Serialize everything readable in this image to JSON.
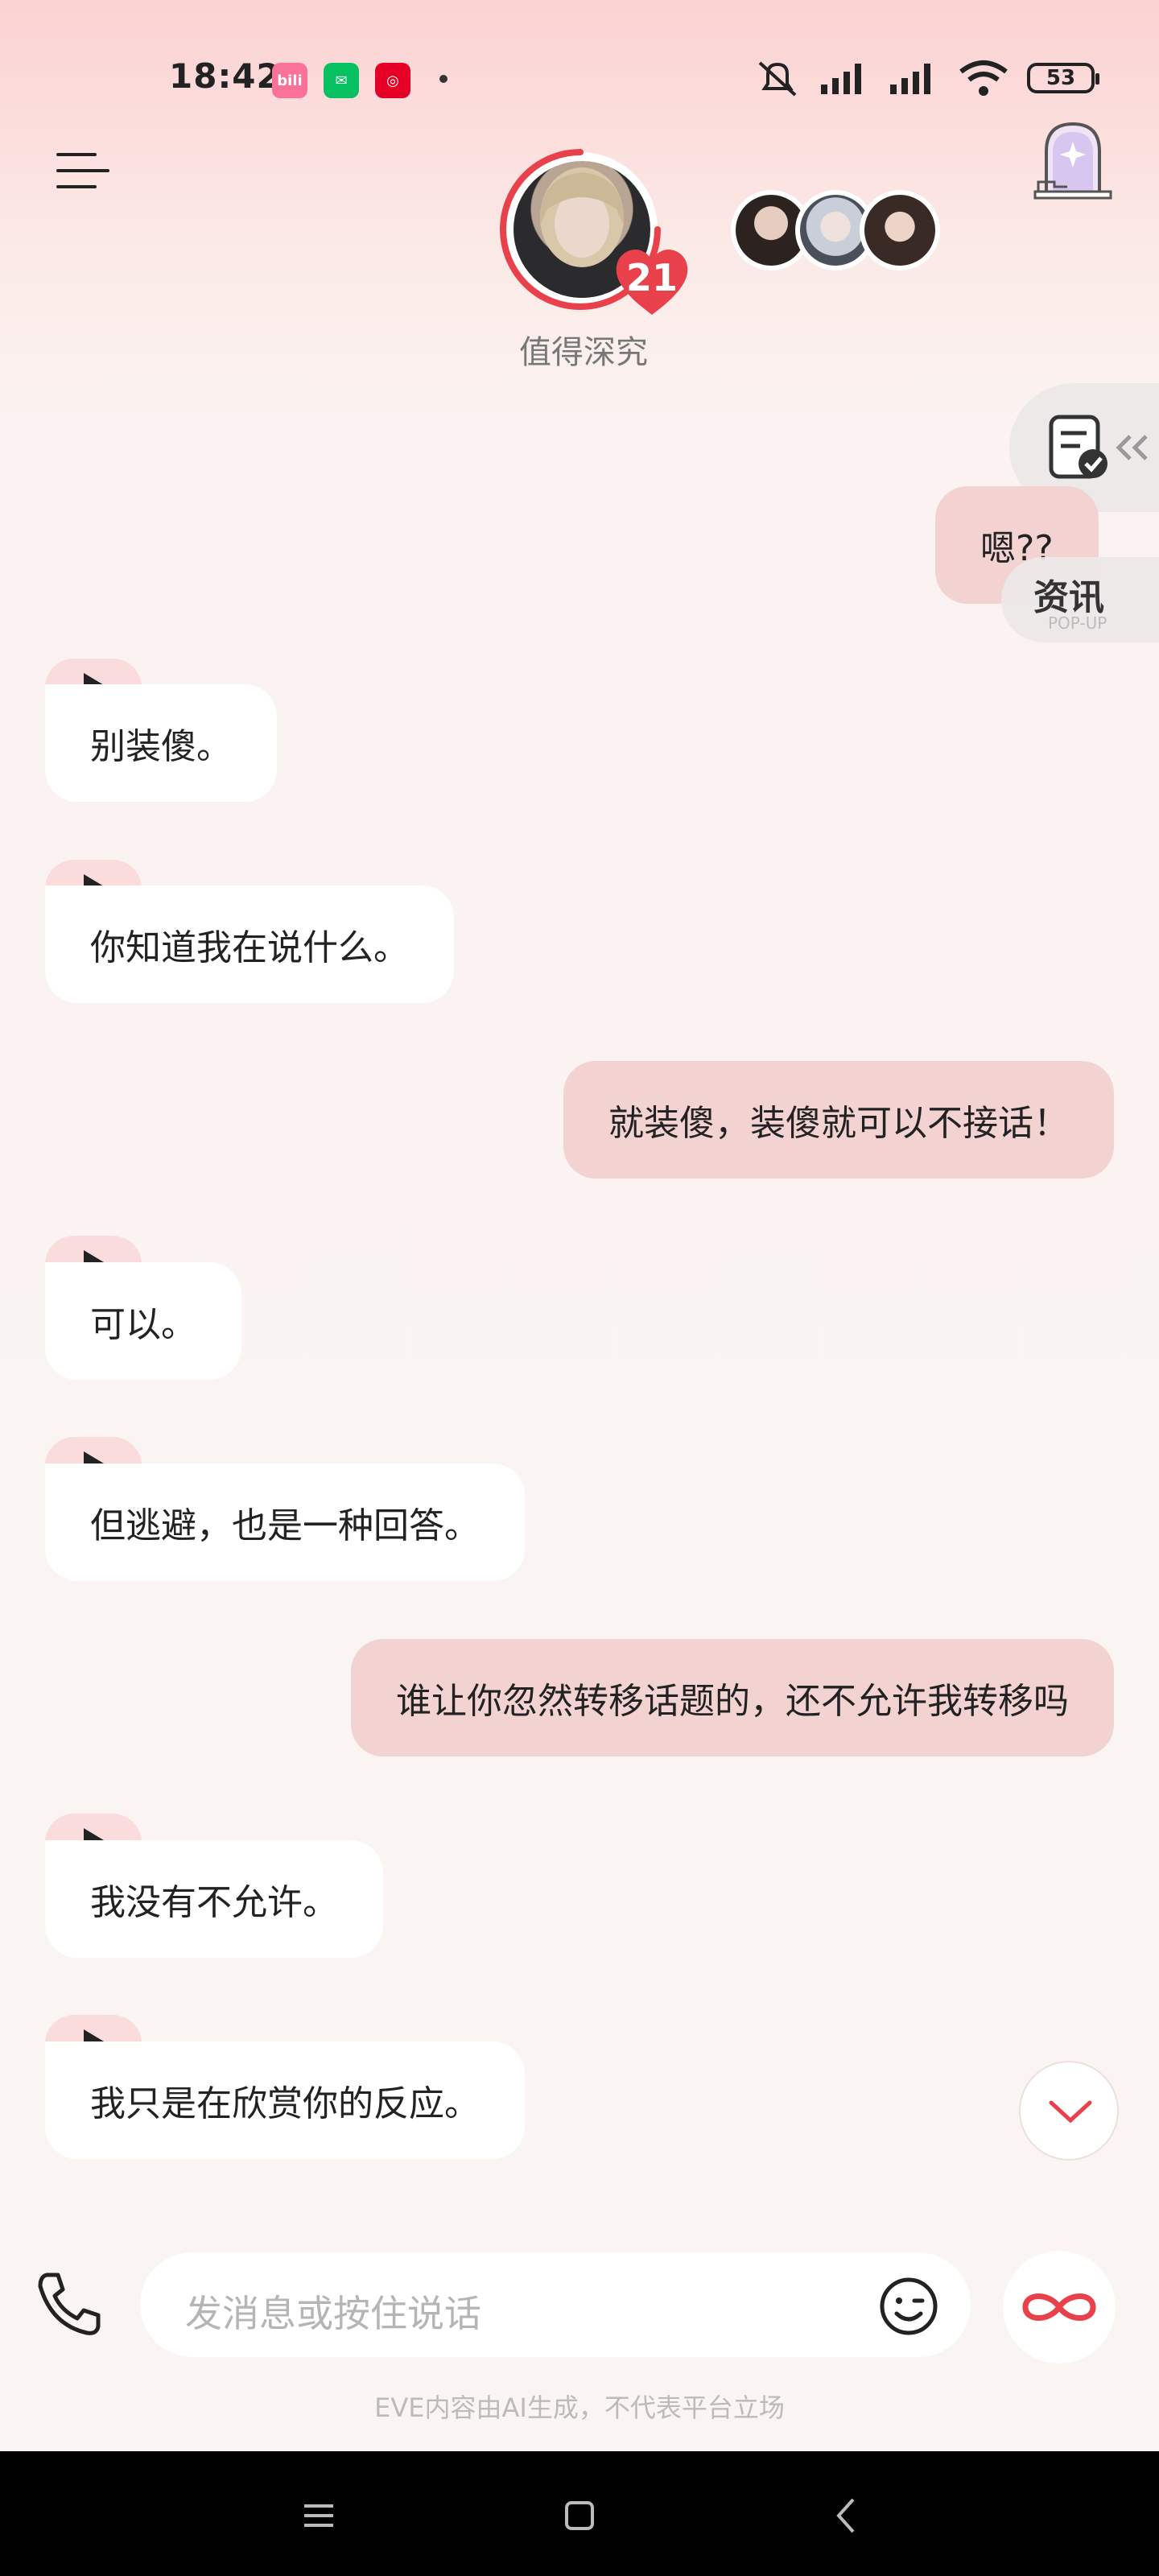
{
  "status_bar": {
    "time": "18:42",
    "apps": [
      {
        "name": "bilibili-icon",
        "color": "#fb7299",
        "glyph": "bili"
      },
      {
        "name": "wechat-icon",
        "color": "#07c160",
        "glyph": "✉"
      },
      {
        "name": "netease-music-icon",
        "color": "#e60026",
        "glyph": "◎"
      }
    ],
    "battery": "53"
  },
  "header": {
    "affection_level": "21",
    "status_text": "值得深究"
  },
  "float_news": {
    "label": "资讯",
    "sub": "POP-UP"
  },
  "messages": [
    {
      "role": "me",
      "text": "嗯??"
    },
    {
      "role": "ai",
      "text": "别装傻。"
    },
    {
      "role": "ai",
      "text": "你知道我在说什么。"
    },
    {
      "role": "me",
      "text": "就装傻，装傻就可以不接话！"
    },
    {
      "role": "ai",
      "text": "可以。"
    },
    {
      "role": "ai",
      "text": "但逃避，也是一种回答。"
    },
    {
      "role": "me",
      "text": "谁让你忽然转移话题的，还不允许我转移吗"
    },
    {
      "role": "ai",
      "text": "我没有不允许。"
    },
    {
      "role": "ai",
      "text": "我只是在欣赏你的反应。"
    }
  ],
  "input": {
    "placeholder": "发消息或按住说话"
  },
  "disclaimer": "EVE内容由AI生成，不代表平台立场",
  "colors": {
    "accent": "#e8414b",
    "bubble_me": "#f2d3d1",
    "bubble_ai": "#ffffff",
    "play_tab": "#fadcdc"
  }
}
